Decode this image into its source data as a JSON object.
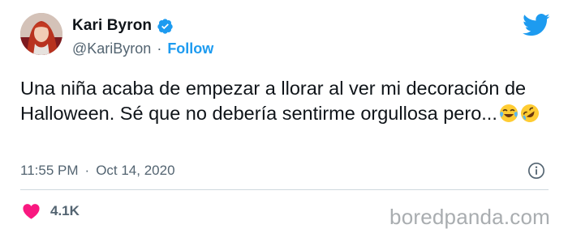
{
  "author": {
    "display_name": "Kari Byron",
    "handle": "@KariByron",
    "follow_label": "Follow"
  },
  "tweet": {
    "text": "Una niña acaba de empezar a llorar al ver mi decoración de Halloween. Sé que no debería sentirme orgullosa pero...",
    "time": "11:55 PM",
    "date": "Oct 14, 2020"
  },
  "engagement": {
    "likes": "4.1K"
  },
  "watermark": "boredpanda.com",
  "separator": "·",
  "icons": {
    "verified": "verified-badge-icon",
    "twitter": "twitter-bird-icon",
    "info": "info-icon",
    "heart": "heart-icon",
    "emoji_1": "face-with-tears-of-joy-emoji",
    "emoji_2": "rolling-on-floor-laughing-emoji"
  },
  "colors": {
    "accent": "#1d9bf0",
    "heart": "#f91880",
    "secondary_text": "#536471",
    "watermark": "#a9adb0"
  }
}
